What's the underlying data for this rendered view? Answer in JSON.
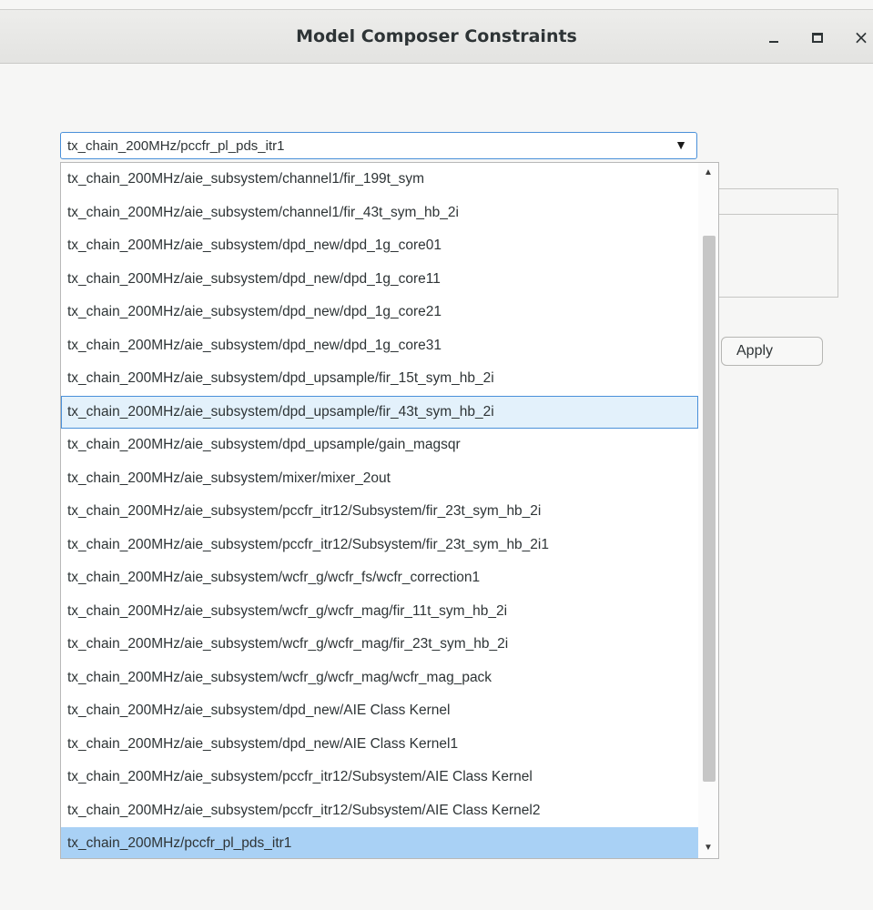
{
  "window": {
    "title": "Model Composer Constraints",
    "close_glyph": "×"
  },
  "combo": {
    "value": "tx_chain_200MHz/pccfr_pl_pds_itr1",
    "arrow": "▼"
  },
  "apply_label": "Apply",
  "dropdown": {
    "scroll_up": "▲",
    "scroll_down": "▼",
    "items": [
      "tx_chain_200MHz/aie_subsystem/channel1/fir_199t_sym",
      "tx_chain_200MHz/aie_subsystem/channel1/fir_43t_sym_hb_2i",
      "tx_chain_200MHz/aie_subsystem/dpd_new/dpd_1g_core01",
      "tx_chain_200MHz/aie_subsystem/dpd_new/dpd_1g_core11",
      "tx_chain_200MHz/aie_subsystem/dpd_new/dpd_1g_core21",
      "tx_chain_200MHz/aie_subsystem/dpd_new/dpd_1g_core31",
      "tx_chain_200MHz/aie_subsystem/dpd_upsample/fir_15t_sym_hb_2i",
      "tx_chain_200MHz/aie_subsystem/dpd_upsample/fir_43t_sym_hb_2i",
      "tx_chain_200MHz/aie_subsystem/dpd_upsample/gain_magsqr",
      "tx_chain_200MHz/aie_subsystem/mixer/mixer_2out",
      "tx_chain_200MHz/aie_subsystem/pccfr_itr12/Subsystem/fir_23t_sym_hb_2i",
      "tx_chain_200MHz/aie_subsystem/pccfr_itr12/Subsystem/fir_23t_sym_hb_2i1",
      "tx_chain_200MHz/aie_subsystem/wcfr_g/wcfr_fs/wcfr_correction1",
      "tx_chain_200MHz/aie_subsystem/wcfr_g/wcfr_mag/fir_11t_sym_hb_2i",
      "tx_chain_200MHz/aie_subsystem/wcfr_g/wcfr_mag/fir_23t_sym_hb_2i",
      "tx_chain_200MHz/aie_subsystem/wcfr_g/wcfr_mag/wcfr_mag_pack",
      "tx_chain_200MHz/aie_subsystem/dpd_new/AIE Class Kernel",
      "tx_chain_200MHz/aie_subsystem/dpd_new/AIE Class Kernel1",
      "tx_chain_200MHz/aie_subsystem/pccfr_itr12/Subsystem/AIE Class Kernel",
      "tx_chain_200MHz/aie_subsystem/pccfr_itr12/Subsystem/AIE Class Kernel2",
      "tx_chain_200MHz/pccfr_pl_pds_itr1"
    ],
    "hover_index": 7,
    "selected_index": 20
  },
  "colors": {
    "accent": "#4a90d9",
    "selected_bg": "#a9d1f5",
    "hover_bg": "#e3f1fb"
  }
}
